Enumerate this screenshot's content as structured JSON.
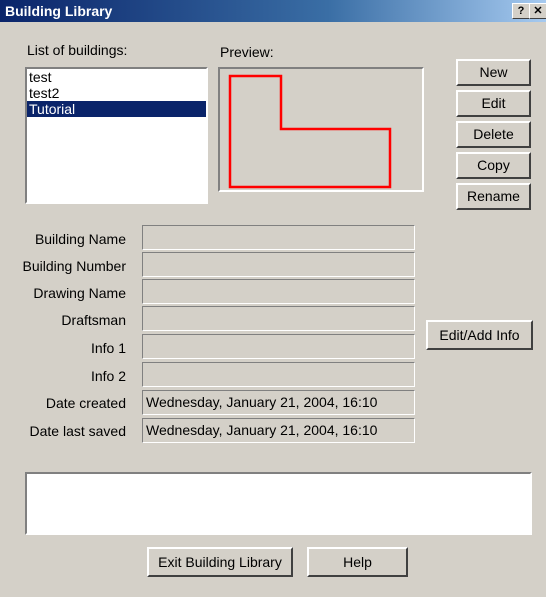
{
  "window": {
    "title": "Building Library",
    "help_glyph": "?",
    "close_glyph": "✕"
  },
  "list": {
    "label": "List of buildings:",
    "items": [
      "test",
      "test2",
      "Tutorial"
    ],
    "selected_index": 2
  },
  "preview": {
    "label": "Preview:",
    "outline_color": "#ff0000"
  },
  "buttons": {
    "new": "New",
    "edit": "Edit",
    "delete": "Delete",
    "copy": "Copy",
    "rename": "Rename",
    "edit_add_info": "Edit/Add Info",
    "exit": "Exit Building Library",
    "help": "Help"
  },
  "fields": [
    {
      "label": "Building Name",
      "value": ""
    },
    {
      "label": "Building Number",
      "value": ""
    },
    {
      "label": "Drawing Name",
      "value": ""
    },
    {
      "label": "Draftsman",
      "value": ""
    },
    {
      "label": "Info 1",
      "value": ""
    },
    {
      "label": "Info 2",
      "value": ""
    },
    {
      "label": "Date created",
      "value": "Wednesday, January 21, 2004, 16:10"
    },
    {
      "label": "Date last saved",
      "value": "Wednesday, January 21, 2004, 16:10"
    }
  ],
  "status_box": {
    "text": ""
  }
}
